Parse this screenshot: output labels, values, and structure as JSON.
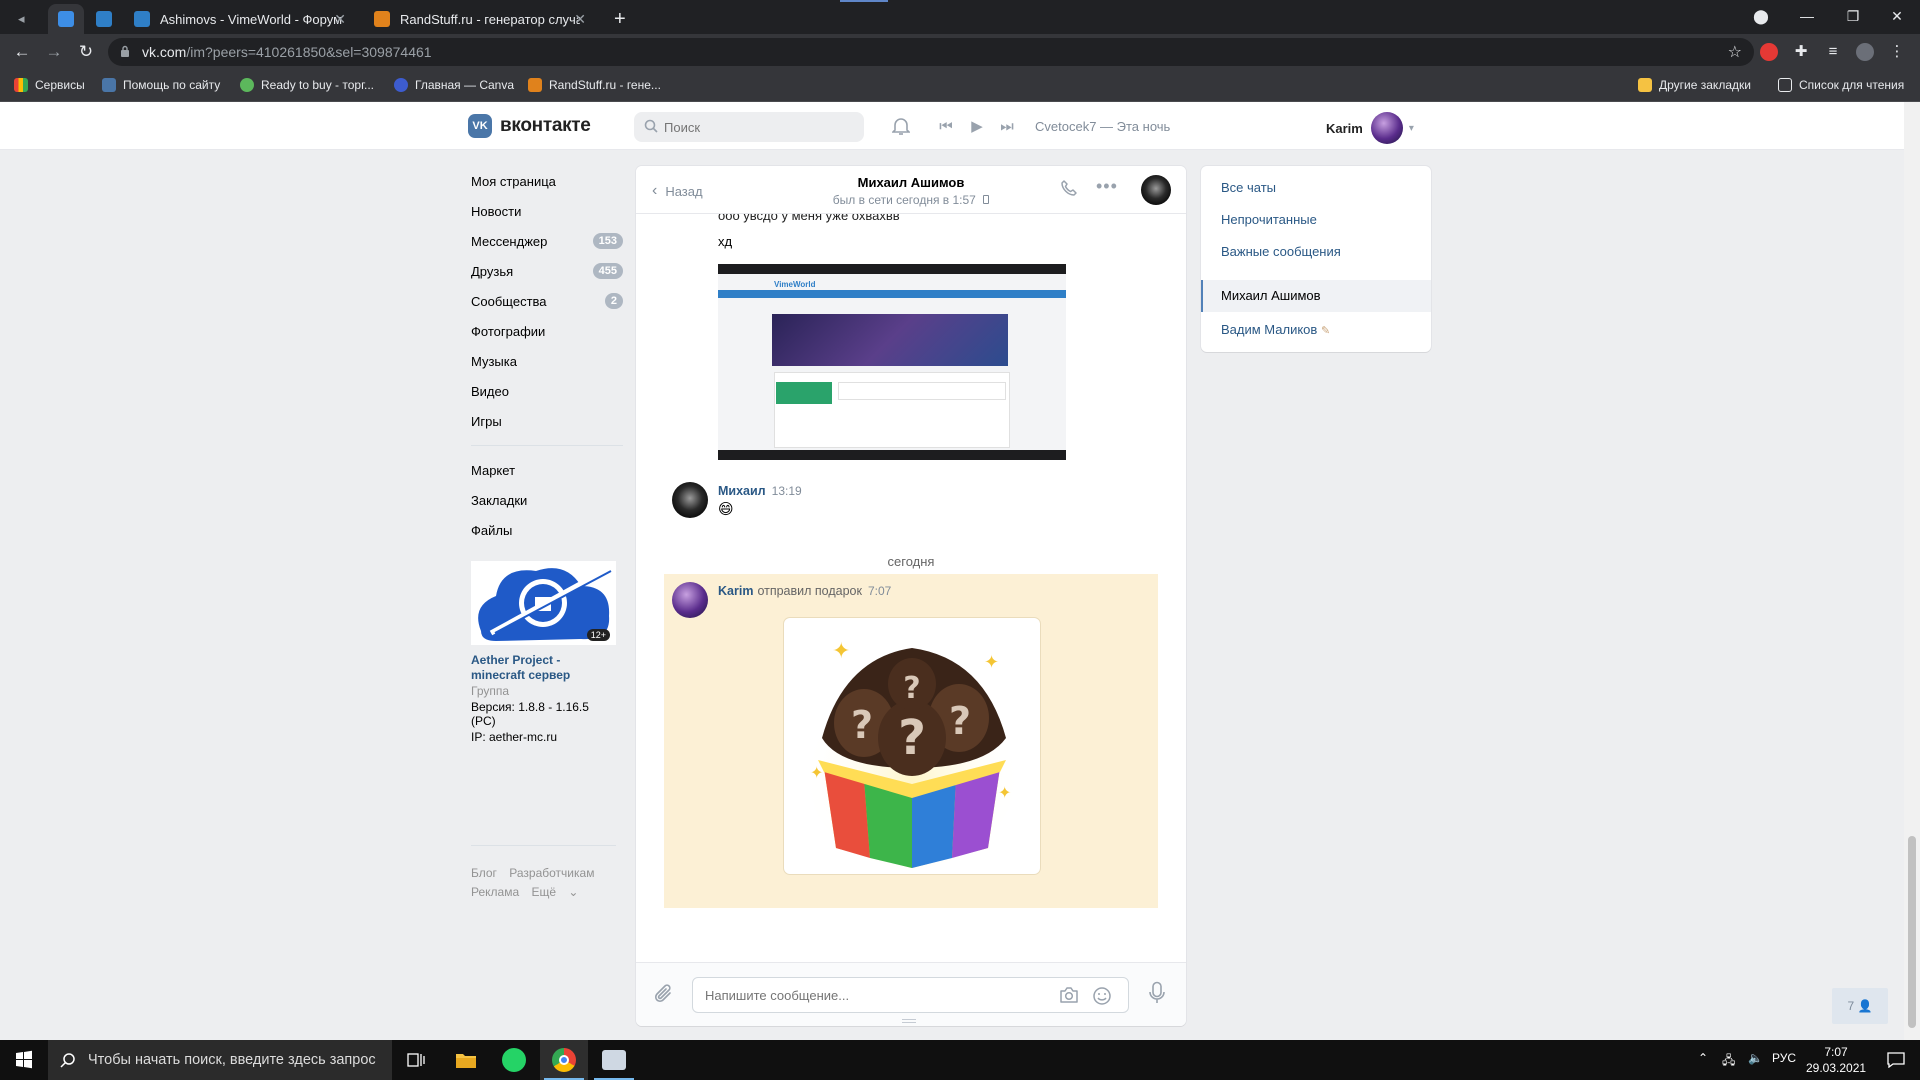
{
  "browser": {
    "tabs": [
      {
        "title": ""
      },
      {
        "title": ""
      },
      {
        "title": "Ashimovs - VimeWorld - Форум"
      },
      {
        "title": "RandStuff.ru - генератор случай"
      }
    ],
    "url_host": "vk.com",
    "url_path": "/im?peers=410261850&sel=309874461",
    "bookmarks": [
      {
        "label": "Сервисы"
      },
      {
        "label": "Помощь по сайту"
      },
      {
        "label": "Ready to buy - торг..."
      },
      {
        "label": "Главная — Canva"
      },
      {
        "label": "RandStuff.ru - гене..."
      }
    ],
    "other_bookmarks": "Другие закладки",
    "reading_list": "Список для чтения"
  },
  "vk": {
    "logo_text": "вконтакте",
    "search_placeholder": "Поиск",
    "player_track": "Cvetocek7 — Эта ночь",
    "user_name": "Karim",
    "menu": [
      {
        "label": "Моя страница",
        "icon": "user-circle-icon"
      },
      {
        "label": "Новости",
        "icon": "newspaper-icon"
      },
      {
        "label": "Мессенджер",
        "icon": "message-icon",
        "badge": "153"
      },
      {
        "label": "Друзья",
        "icon": "friends-icon",
        "badge": "455"
      },
      {
        "label": "Сообщества",
        "icon": "groups-icon",
        "badge": "2"
      },
      {
        "label": "Фотографии",
        "icon": "photo-icon"
      },
      {
        "label": "Музыка",
        "icon": "music-icon"
      },
      {
        "label": "Видео",
        "icon": "video-icon"
      },
      {
        "label": "Игры",
        "icon": "gamepad-icon"
      }
    ],
    "menu2": [
      {
        "label": "Маркет",
        "icon": "bag-icon"
      },
      {
        "label": "Закладки",
        "icon": "star-icon"
      },
      {
        "label": "Файлы",
        "icon": "file-icon"
      }
    ],
    "ad": {
      "age": "12+",
      "name": "Aether Project - minecraft сервер",
      "type": "Группа",
      "line1": "Версия: 1.8.8 - 1.16.5 (PC)",
      "line2": "IP: aether-mc.ru"
    },
    "footer": {
      "blog": "Блог",
      "devs": "Разработчикам",
      "ads": "Реклама",
      "more": "Ещё"
    }
  },
  "chat": {
    "back_label": "Назад",
    "peer_name": "Михаил Ашимов",
    "peer_status": "был в сети сегодня в 1:57",
    "partial_line": "ооо увсдо у меня уже охвахвв",
    "msg_xd": "хд",
    "screenshot_site": "VimeWorld",
    "msg2_author": "Михаил",
    "msg2_time": "13:19",
    "msg2_emoji": "😄",
    "day_separator": "сегодня",
    "msg3_author": "Karim",
    "msg3_action": "отправил подарок",
    "msg3_time": "7:07",
    "input_placeholder": "Напишите сообщение..."
  },
  "filters": {
    "all": "Все чаты",
    "unread": "Непрочитанные",
    "important": "Важные сообщения",
    "dialog1": "Михаил Ашимов",
    "dialog2": "Вадим Маликов",
    "dialog2_icon": "pencil-icon"
  },
  "float_counter": "7",
  "taskbar": {
    "search_text": "Чтобы начать поиск, введите здесь запрос",
    "lang": "РУС",
    "time": "7:07",
    "date": "29.03.2021"
  },
  "colors": {
    "vk_blue": "#4a76a8",
    "link": "#2a5885",
    "gift_bg": "#fcf0d5"
  }
}
